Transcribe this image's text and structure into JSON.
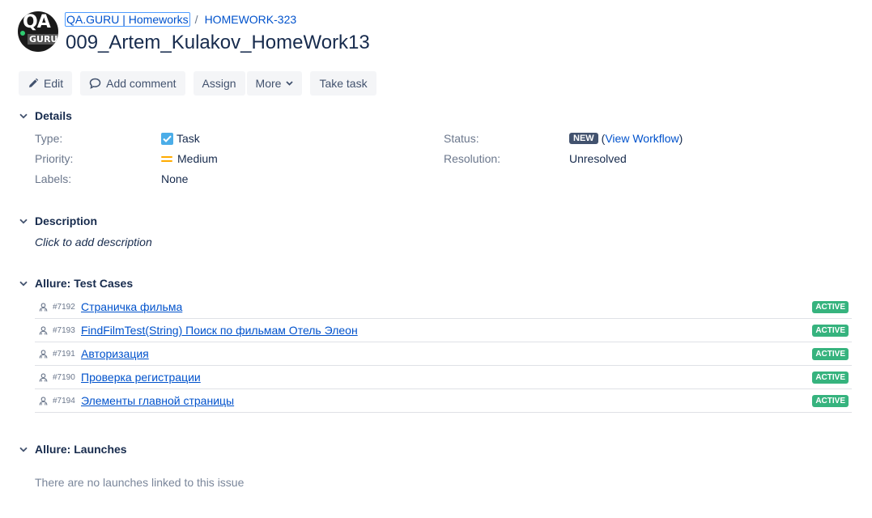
{
  "header": {
    "logo_text_top": "QA",
    "logo_text_bottom": "GURU",
    "breadcrumb": {
      "project": "QA.GURU | Homeworks",
      "separator": "/",
      "issue_key": "HOMEWORK-323"
    },
    "title": "009_Artem_Kulakov_HomeWork13"
  },
  "toolbar": {
    "edit": "Edit",
    "add_comment": "Add comment",
    "assign": "Assign",
    "more": "More",
    "take_task": "Take task"
  },
  "details": {
    "heading": "Details",
    "type_label": "Type:",
    "type_value": "Task",
    "priority_label": "Priority:",
    "priority_value": "Medium",
    "labels_label": "Labels:",
    "labels_value": "None",
    "status_label": "Status:",
    "status_badge": "NEW",
    "status_open_paren": "(",
    "status_link": "View Workflow",
    "status_close_paren": ")",
    "resolution_label": "Resolution:",
    "resolution_value": "Unresolved"
  },
  "description": {
    "heading": "Description",
    "placeholder": "Click to add description"
  },
  "test_cases": {
    "heading": "Allure: Test Cases",
    "rows": [
      {
        "id": "#7192",
        "name": "Страничка фильма",
        "status": "ACTIVE"
      },
      {
        "id": "#7193",
        "name": "FindFilmTest(String) Поиск по фильмам Отель Элеон",
        "status": "ACTIVE"
      },
      {
        "id": "#7191",
        "name": "Авторизация",
        "status": "ACTIVE"
      },
      {
        "id": "#7190",
        "name": "Проверка регистрации",
        "status": "ACTIVE"
      },
      {
        "id": "#7194",
        "name": "Элементы главной страницы",
        "status": "ACTIVE"
      }
    ]
  },
  "launches": {
    "heading": "Allure: Launches",
    "empty_text": "There are no launches linked to this issue"
  },
  "colors": {
    "link": "#0052cc",
    "active_badge": "#36b37e",
    "new_badge": "#42526e",
    "task_icon": "#4bade8",
    "medium_priority": "#ffab00"
  }
}
